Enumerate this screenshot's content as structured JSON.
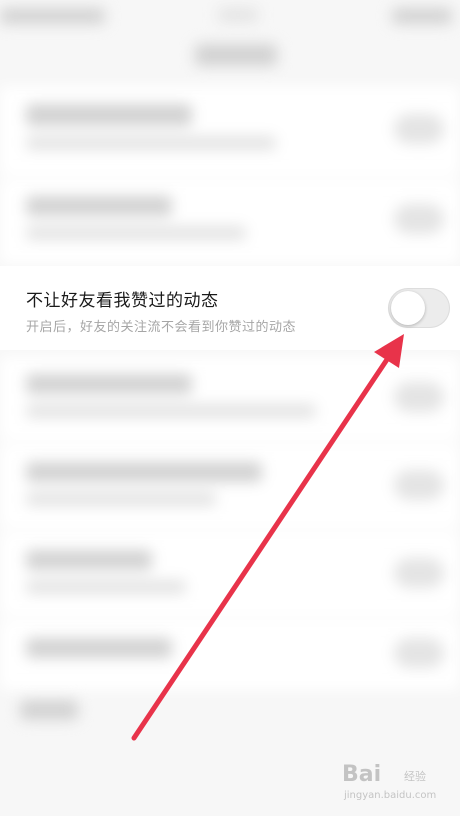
{
  "setting": {
    "title": "不让好友看我赞过的动态",
    "subtitle": "开启后，好友的关注流不会看到你赞过的动态",
    "toggle_state": "off"
  },
  "watermark": {
    "logo": "Bai",
    "text_cn": "经验",
    "url": "jingyan.baidu.com"
  },
  "colors": {
    "arrow": "#e8334a",
    "toggle_off": "#ececec"
  }
}
